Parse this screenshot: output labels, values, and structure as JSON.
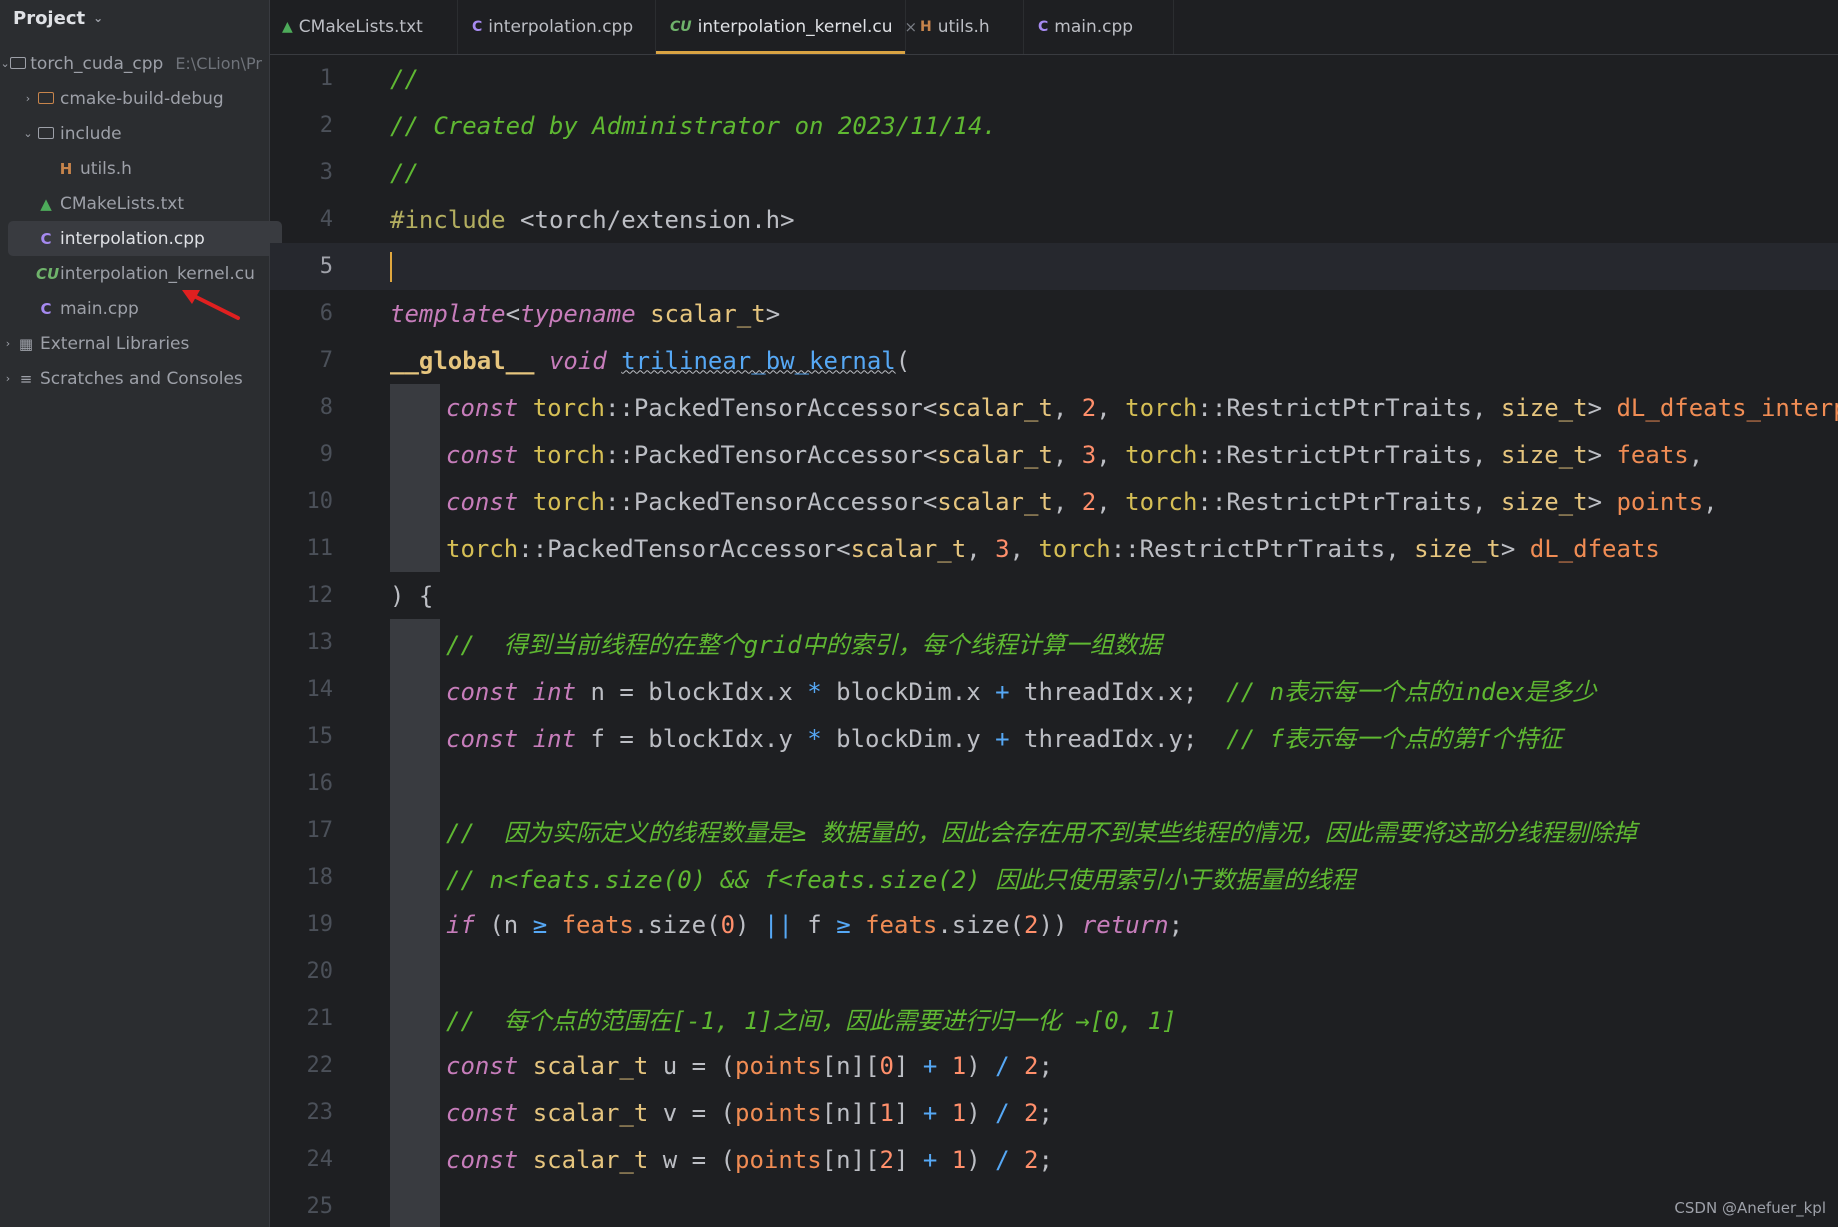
{
  "sidebar": {
    "title": "Project",
    "items": [
      {
        "label": "torch_cuda_cpp",
        "hint": "E:\\CLion\\Pr"
      },
      {
        "label": "cmake-build-debug"
      },
      {
        "label": "include"
      },
      {
        "label": "utils.h"
      },
      {
        "label": "CMakeLists.txt"
      },
      {
        "label": "interpolation.cpp"
      },
      {
        "label": "interpolation_kernel.cu"
      },
      {
        "label": "main.cpp"
      },
      {
        "label": "External Libraries"
      },
      {
        "label": "Scratches and Consoles"
      }
    ]
  },
  "tabs": [
    {
      "label": "CMakeLists.txt"
    },
    {
      "label": "interpolation.cpp"
    },
    {
      "label": "interpolation_kernel.cu"
    },
    {
      "label": "utils.h"
    },
    {
      "label": "main.cpp"
    }
  ],
  "icons": {
    "folder": "folder-icon",
    "header": "h-file-icon",
    "cmake": "cmake-icon",
    "cpp": "cpp-file-icon",
    "cuda": "cuda-file-icon",
    "close": "close-icon"
  },
  "colors": {
    "accent_tab": "#d9a343",
    "comment": "#5fb832",
    "annotation_arrow": "#e02020"
  },
  "editor": {
    "current_line": 5,
    "line_numbers": [
      "1",
      "2",
      "3",
      "4",
      "5",
      "6",
      "7",
      "8",
      "9",
      "10",
      "11",
      "12",
      "13",
      "14",
      "15",
      "16",
      "17",
      "18",
      "19",
      "20",
      "21",
      "22",
      "23",
      "24",
      "25"
    ],
    "lines": {
      "l1": "//",
      "l2": "// Created by Administrator on 2023/11/14.",
      "l3": "//",
      "l4_directive": "#include",
      "l4_path": "<torch/extension.h>",
      "l6_template": "template",
      "l6_typename": "typename",
      "l6_type": "scalar_t",
      "l7_global": "__global__",
      "l7_void": "void",
      "l7_fn": "trilinear_bw_kernal",
      "const": "const",
      "int": "int",
      "if": "if",
      "return": "return",
      "torch": "torch",
      "scalar_t": "scalar_t",
      "size_t": "size_t",
      "accessor": "PackedTensorAccessor",
      "traits": "RestrictPtrTraits",
      "p1": "dL_dfeats_interp",
      "p2": "feats",
      "p3": "points",
      "p4": "dL_dfeats",
      "c13": "//  得到当前线程的在整个grid中的索引，每个线程计算一组数据",
      "c14": "// n表示每一个点的index是多少",
      "c15": "// f表示每一个点的第f个特征",
      "c17": "//  因为实际定义的线程数量是≥ 数据量的，因此会存在用不到某些线程的情况，因此需要将这部分线程剔除掉",
      "c18": "// n<feats.size(0) && f<feats.size(2) 因此只使用索引小于数据量的线程",
      "c21": "//  每个点的范围在[-1, 1]之间，因此需要进行归一化 →[0, 1]"
    }
  },
  "watermark": "CSDN @Anefuer_kpl"
}
